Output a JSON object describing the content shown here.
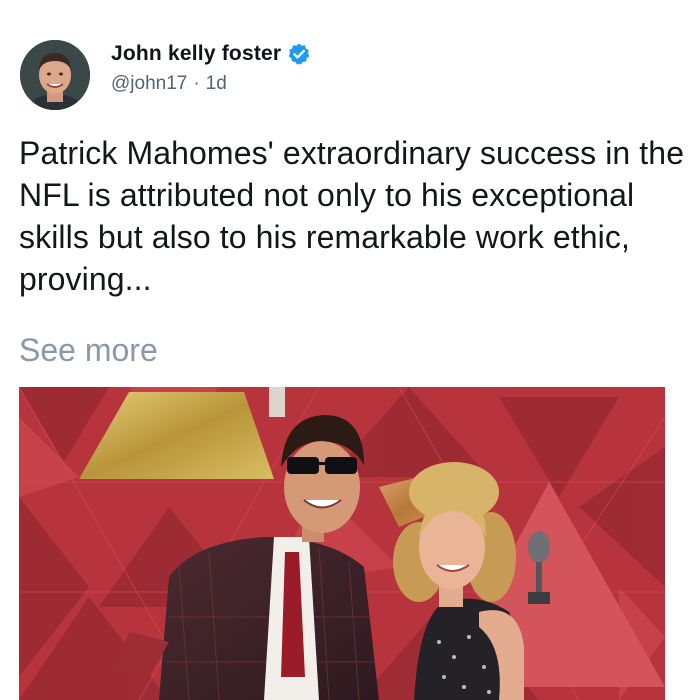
{
  "author": {
    "name": "John kelly foster",
    "handle": "@john17",
    "separator": "·",
    "time": "1d",
    "verified_icon": "verified-badge-icon"
  },
  "post": {
    "text": "Patrick Mahomes' extraordinary success in the NFL is attributed not only to his exceptional skills but also to his remarkable work ethic, proving...",
    "see_more": "See more"
  },
  "colors": {
    "verified": "#1d9bf0",
    "meta_gray": "#536471",
    "see_more_gray": "#8b98a5",
    "backdrop_red": "#b8343c",
    "gold": "#c9a842"
  }
}
